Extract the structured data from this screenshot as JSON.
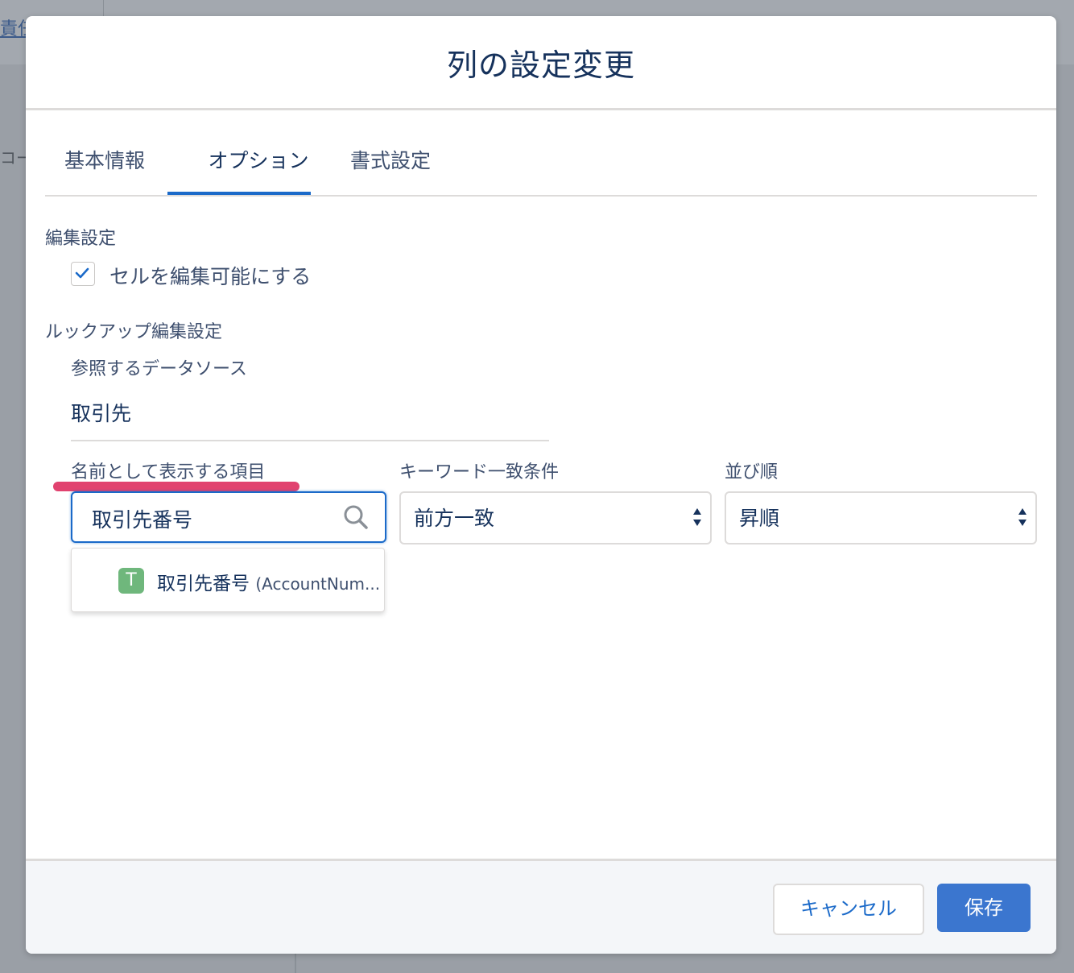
{
  "background": {
    "link_text": "責任者",
    "side_text": "コー"
  },
  "modal": {
    "title": "列の設定変更",
    "tabs": [
      "基本情報",
      "オプション",
      "書式設定"
    ],
    "active_tab": "オプション",
    "edit_section": {
      "heading": "編集設定",
      "checkbox_label": "セルを編集可能にする",
      "checked": true
    },
    "lookup_section": {
      "heading": "ルックアップ編集設定",
      "datasource_label": "参照するデータソース",
      "datasource_value": "取引先",
      "name_field_label": "名前として表示する項目",
      "name_field_value": "取引先番号",
      "match_label": "キーワード一致条件",
      "match_value": "前方一致",
      "order_label": "並び順",
      "order_value": "昇順",
      "option": {
        "badge": "T",
        "label": "取引先番号",
        "api": "(AccountNum..."
      }
    },
    "footer": {
      "cancel": "キャンセル",
      "save": "保存"
    }
  },
  "colors": {
    "accent": "#1b6ac9",
    "highlight": "#e1426f",
    "badge": "#6fb77c",
    "save_button": "#3b76cf"
  }
}
